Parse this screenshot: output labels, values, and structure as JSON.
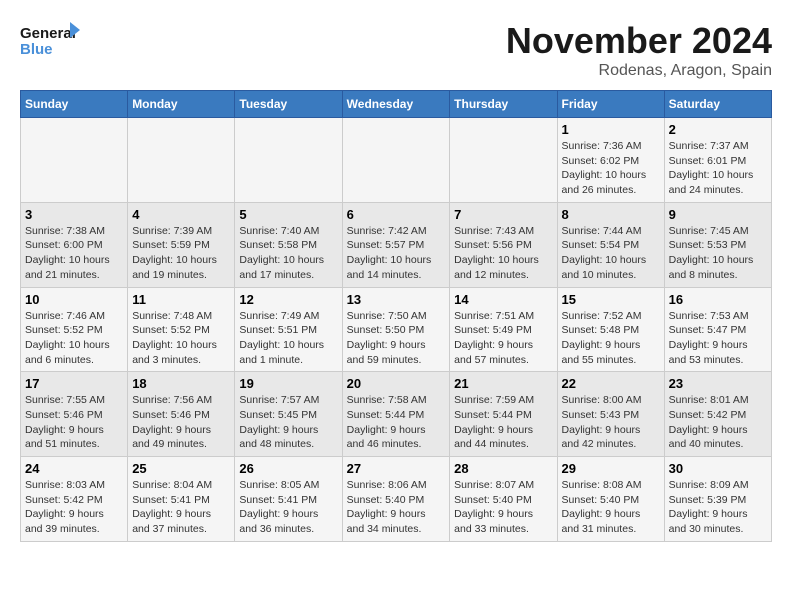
{
  "header": {
    "logo_line1": "General",
    "logo_line2": "Blue",
    "month": "November 2024",
    "location": "Rodenas, Aragon, Spain"
  },
  "weekdays": [
    "Sunday",
    "Monday",
    "Tuesday",
    "Wednesday",
    "Thursday",
    "Friday",
    "Saturday"
  ],
  "weeks": [
    [
      {
        "day": "",
        "info": ""
      },
      {
        "day": "",
        "info": ""
      },
      {
        "day": "",
        "info": ""
      },
      {
        "day": "",
        "info": ""
      },
      {
        "day": "",
        "info": ""
      },
      {
        "day": "1",
        "info": "Sunrise: 7:36 AM\nSunset: 6:02 PM\nDaylight: 10 hours and 26 minutes."
      },
      {
        "day": "2",
        "info": "Sunrise: 7:37 AM\nSunset: 6:01 PM\nDaylight: 10 hours and 24 minutes."
      }
    ],
    [
      {
        "day": "3",
        "info": "Sunrise: 7:38 AM\nSunset: 6:00 PM\nDaylight: 10 hours and 21 minutes."
      },
      {
        "day": "4",
        "info": "Sunrise: 7:39 AM\nSunset: 5:59 PM\nDaylight: 10 hours and 19 minutes."
      },
      {
        "day": "5",
        "info": "Sunrise: 7:40 AM\nSunset: 5:58 PM\nDaylight: 10 hours and 17 minutes."
      },
      {
        "day": "6",
        "info": "Sunrise: 7:42 AM\nSunset: 5:57 PM\nDaylight: 10 hours and 14 minutes."
      },
      {
        "day": "7",
        "info": "Sunrise: 7:43 AM\nSunset: 5:56 PM\nDaylight: 10 hours and 12 minutes."
      },
      {
        "day": "8",
        "info": "Sunrise: 7:44 AM\nSunset: 5:54 PM\nDaylight: 10 hours and 10 minutes."
      },
      {
        "day": "9",
        "info": "Sunrise: 7:45 AM\nSunset: 5:53 PM\nDaylight: 10 hours and 8 minutes."
      }
    ],
    [
      {
        "day": "10",
        "info": "Sunrise: 7:46 AM\nSunset: 5:52 PM\nDaylight: 10 hours and 6 minutes."
      },
      {
        "day": "11",
        "info": "Sunrise: 7:48 AM\nSunset: 5:52 PM\nDaylight: 10 hours and 3 minutes."
      },
      {
        "day": "12",
        "info": "Sunrise: 7:49 AM\nSunset: 5:51 PM\nDaylight: 10 hours and 1 minute."
      },
      {
        "day": "13",
        "info": "Sunrise: 7:50 AM\nSunset: 5:50 PM\nDaylight: 9 hours and 59 minutes."
      },
      {
        "day": "14",
        "info": "Sunrise: 7:51 AM\nSunset: 5:49 PM\nDaylight: 9 hours and 57 minutes."
      },
      {
        "day": "15",
        "info": "Sunrise: 7:52 AM\nSunset: 5:48 PM\nDaylight: 9 hours and 55 minutes."
      },
      {
        "day": "16",
        "info": "Sunrise: 7:53 AM\nSunset: 5:47 PM\nDaylight: 9 hours and 53 minutes."
      }
    ],
    [
      {
        "day": "17",
        "info": "Sunrise: 7:55 AM\nSunset: 5:46 PM\nDaylight: 9 hours and 51 minutes."
      },
      {
        "day": "18",
        "info": "Sunrise: 7:56 AM\nSunset: 5:46 PM\nDaylight: 9 hours and 49 minutes."
      },
      {
        "day": "19",
        "info": "Sunrise: 7:57 AM\nSunset: 5:45 PM\nDaylight: 9 hours and 48 minutes."
      },
      {
        "day": "20",
        "info": "Sunrise: 7:58 AM\nSunset: 5:44 PM\nDaylight: 9 hours and 46 minutes."
      },
      {
        "day": "21",
        "info": "Sunrise: 7:59 AM\nSunset: 5:44 PM\nDaylight: 9 hours and 44 minutes."
      },
      {
        "day": "22",
        "info": "Sunrise: 8:00 AM\nSunset: 5:43 PM\nDaylight: 9 hours and 42 minutes."
      },
      {
        "day": "23",
        "info": "Sunrise: 8:01 AM\nSunset: 5:42 PM\nDaylight: 9 hours and 40 minutes."
      }
    ],
    [
      {
        "day": "24",
        "info": "Sunrise: 8:03 AM\nSunset: 5:42 PM\nDaylight: 9 hours and 39 minutes."
      },
      {
        "day": "25",
        "info": "Sunrise: 8:04 AM\nSunset: 5:41 PM\nDaylight: 9 hours and 37 minutes."
      },
      {
        "day": "26",
        "info": "Sunrise: 8:05 AM\nSunset: 5:41 PM\nDaylight: 9 hours and 36 minutes."
      },
      {
        "day": "27",
        "info": "Sunrise: 8:06 AM\nSunset: 5:40 PM\nDaylight: 9 hours and 34 minutes."
      },
      {
        "day": "28",
        "info": "Sunrise: 8:07 AM\nSunset: 5:40 PM\nDaylight: 9 hours and 33 minutes."
      },
      {
        "day": "29",
        "info": "Sunrise: 8:08 AM\nSunset: 5:40 PM\nDaylight: 9 hours and 31 minutes."
      },
      {
        "day": "30",
        "info": "Sunrise: 8:09 AM\nSunset: 5:39 PM\nDaylight: 9 hours and 30 minutes."
      }
    ]
  ]
}
